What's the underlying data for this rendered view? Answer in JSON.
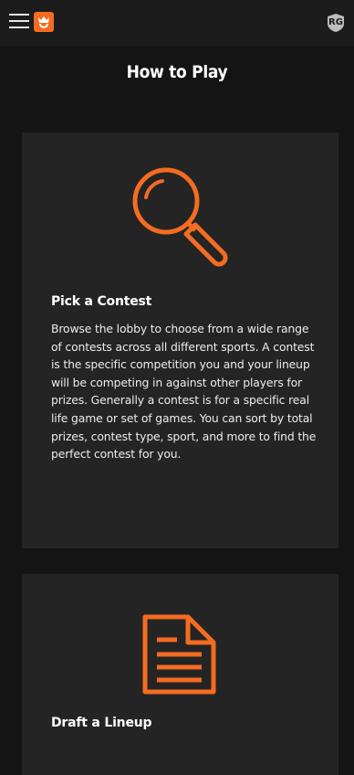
{
  "header": {
    "menu_icon": "hamburger-menu-icon",
    "logo_icon": "draftkings-crown-logo",
    "badge_text": "RG",
    "accent_color": "#f46c22"
  },
  "page": {
    "title": "How to Play"
  },
  "cards": [
    {
      "icon": "magnifying-glass-icon",
      "heading": "Pick a Contest",
      "body": "Browse the lobby to choose from a wide range of contests across all different sports. A contest is the specific competition you and your lineup will be competing in against other players for prizes. Generally a contest is for a specific real life game or set of games. You can sort by total prizes, contest type, sport, and more to find the perfect contest for you."
    },
    {
      "icon": "document-icon",
      "heading": "Draft a Lineup"
    }
  ]
}
